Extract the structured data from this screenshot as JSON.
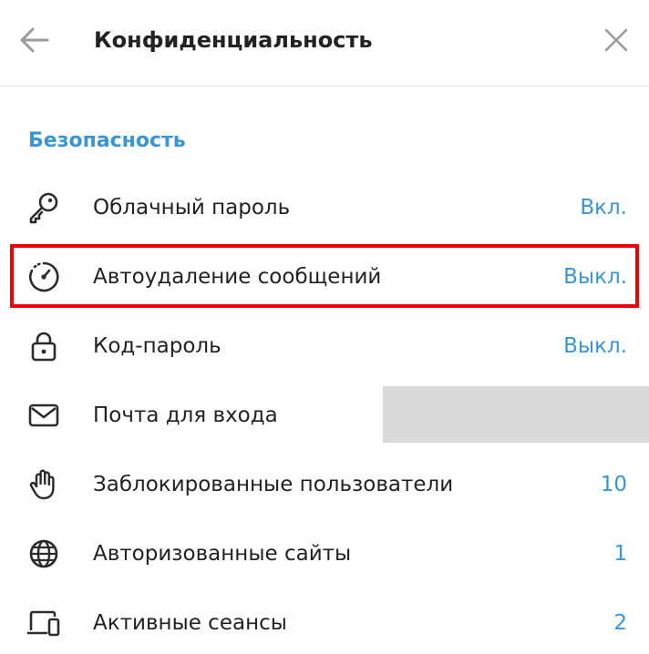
{
  "header": {
    "title": "Конфиденциальность",
    "back_icon": "arrow-left-icon",
    "close_icon": "close-icon"
  },
  "section": {
    "title": "Безопасность"
  },
  "items": [
    {
      "icon": "key-icon",
      "label": "Облачный пароль",
      "value": "Вкл."
    },
    {
      "icon": "timer-icon",
      "label": "Автоудаление сообщений",
      "value": "Выкл."
    },
    {
      "icon": "lock-icon",
      "label": "Код-пароль",
      "value": "Выкл."
    },
    {
      "icon": "mail-icon",
      "label": "Почта для входа",
      "value": ""
    },
    {
      "icon": "hand-icon",
      "label": "Заблокированные пользователи",
      "value": "10"
    },
    {
      "icon": "globe-icon",
      "label": "Авторизованные сайты",
      "value": "1"
    },
    {
      "icon": "devices-icon",
      "label": "Активные сеансы",
      "value": "2"
    }
  ],
  "colors": {
    "accent": "#3a95d5",
    "highlight": "#ee0000",
    "redaction": "#d9d9d9"
  }
}
